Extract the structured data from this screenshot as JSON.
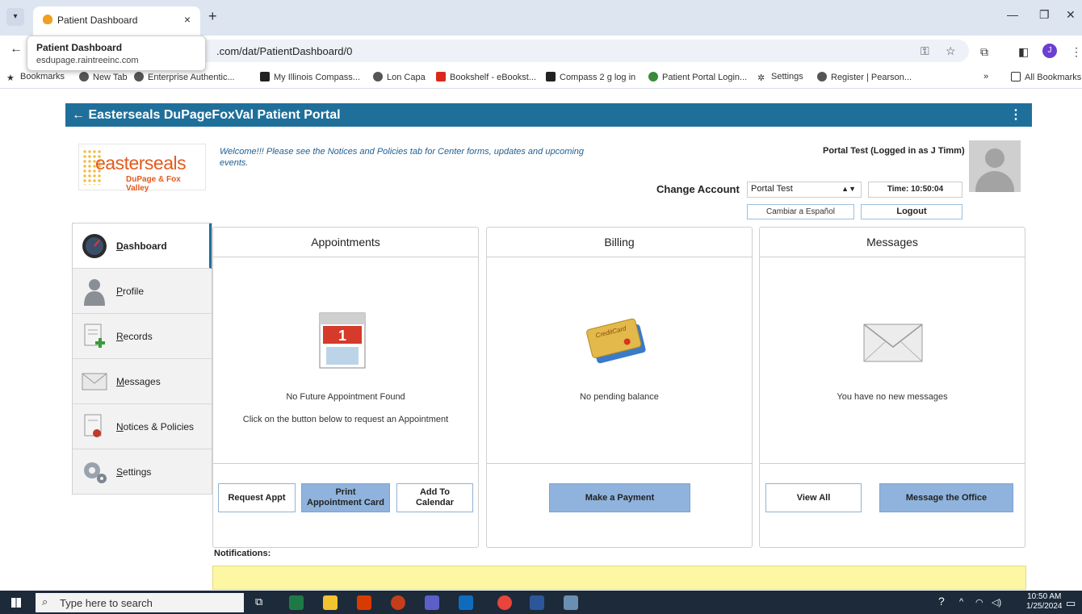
{
  "browser": {
    "tab_title": "Patient Dashboard",
    "tab_close": "×",
    "new_tab": "+",
    "url": ".com/dat/PatientDashboard/0",
    "tooltip_title": "Patient Dashboard",
    "tooltip_url": "esdupage.raintreeinc.com",
    "bookmarks": [
      "Bookmarks",
      "New Tab",
      "Enterprise Authentic...",
      "My Illinois Compass...",
      "Lon Capa",
      "Bookshelf - eBookst...",
      "Compass 2 g log in",
      "Patient Portal Login...",
      "Settings",
      "Register | Pearson..."
    ],
    "all_bookmarks": "All Bookmarks",
    "more": "»"
  },
  "portal": {
    "back": "←",
    "title": "Easterseals DuPageFoxVal Patient Portal",
    "menu": "⋮",
    "logo_main": "easterseals",
    "logo_sub": "DuPage & Fox Valley",
    "welcome": "Welcome!!! Please see the Notices and Policies tab for Center forms, updates and upcoming events.",
    "logged_in": "Portal Test (Logged in as J Timm)",
    "change_account_label": "Change Account",
    "account_value": "Portal Test",
    "time": "Time: 10:50:04",
    "spanish_btn": "Cambiar a Español",
    "logout_btn": "Logout"
  },
  "sidebar": [
    {
      "label": "Dashboard",
      "first": "D",
      "rest": "ashboard"
    },
    {
      "label": "Profile",
      "first": "P",
      "rest": "rofile"
    },
    {
      "label": "Records",
      "first": "R",
      "rest": "ecords"
    },
    {
      "label": "Messages",
      "first": "M",
      "rest": "essages"
    },
    {
      "label": "Notices & Policies",
      "first": "N",
      "rest": "otices & Policies"
    },
    {
      "label": "Settings",
      "first": "S",
      "rest": "ettings"
    }
  ],
  "appointments": {
    "title": "Appointments",
    "line1": "No Future Appointment Found",
    "line2": "Click on the button below to request an Appointment",
    "btn_request": "Request Appt",
    "btn_print_1": "Print",
    "btn_print_2": "Appointment Card",
    "btn_add_1": "Add To",
    "btn_add_2": "Calendar"
  },
  "billing": {
    "title": "Billing",
    "line1": "No pending balance",
    "btn_pay": "Make a Payment",
    "card_text": "CreditCard"
  },
  "messages": {
    "title": "Messages",
    "line1": "You have no new messages",
    "btn_view": "View All",
    "btn_msg": "Message the Office"
  },
  "notifications_label": "Notifications:",
  "taskbar": {
    "search_placeholder": "Type here to search",
    "time": "10:50 AM",
    "date": "1/25/2024"
  }
}
